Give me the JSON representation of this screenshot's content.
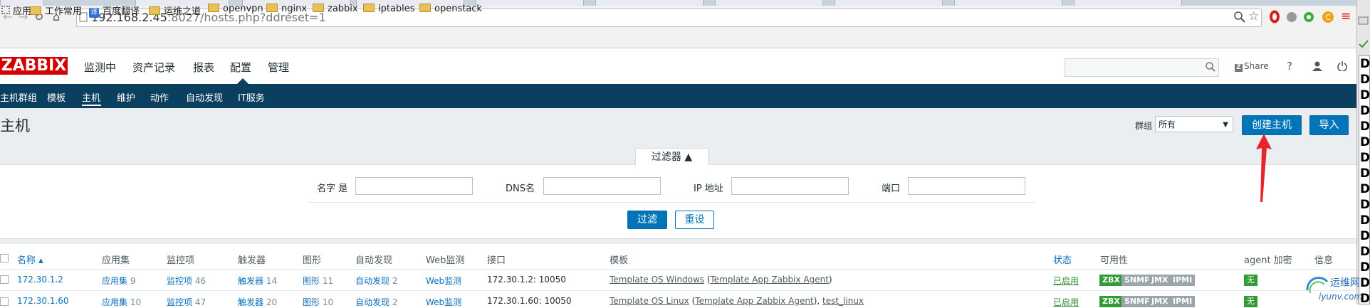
{
  "browser": {
    "url_host": "192.168.2.45",
    "url_rest": ":8027/hosts.php?ddreset=1",
    "bookmarks": [
      "应用",
      "工作常用",
      "百度翻译",
      "运维之道",
      "openvpn",
      "nginx",
      "zabbix",
      "iptables",
      "openstack"
    ]
  },
  "zabbix": {
    "logo": "ZABBIX",
    "main_menu": [
      "监测中",
      "资产记录",
      "报表",
      "配置",
      "管理"
    ],
    "share": "Share",
    "help": "?",
    "sub_menu": [
      "主机群组",
      "模板",
      "主机",
      "维护",
      "动作",
      "自动发现",
      "IT服务"
    ]
  },
  "page": {
    "title": "主机",
    "group_label": "群组",
    "group_value": "所有",
    "create_host": "创建主机",
    "import": "导入"
  },
  "filter": {
    "tab": "过滤器 ▲",
    "name_label": "名字 是",
    "dns_label": "DNS名",
    "ip_label": "IP 地址",
    "port_label": "端口",
    "apply": "过滤",
    "reset": "重设"
  },
  "table": {
    "headers": {
      "name": "名称 ▴",
      "apps": "应用集",
      "items": "监控项",
      "triggers": "触发器",
      "graphs": "图形",
      "discovery": "自动发现",
      "web": "Web监测",
      "interface": "接口",
      "templates": "模板",
      "status": "状态",
      "availability": "可用性",
      "agent_enc": "agent 加密",
      "info": "信息"
    },
    "rows": [
      {
        "name": "172.30.1.2",
        "apps": "应用集",
        "apps_n": "9",
        "items": "监控项",
        "items_n": "46",
        "triggers": "触发器",
        "triggers_n": "14",
        "graphs": "图形",
        "graphs_n": "11",
        "discovery": "自动发现",
        "discovery_n": "2",
        "web": "Web监测",
        "interface": "172.30.1.2: 10050",
        "template": "Template OS Windows",
        "template_paren": "Template App Zabbix Agent",
        "status": "已启用",
        "avail": [
          "ZBX",
          "SNMP",
          "JMX",
          "IPMI"
        ],
        "enc": "无"
      },
      {
        "name": "172.30.1.60",
        "apps": "应用集",
        "apps_n": "10",
        "items": "监控项",
        "items_n": "47",
        "triggers": "触发器",
        "triggers_n": "20",
        "graphs": "图形",
        "graphs_n": "10",
        "discovery": "自动发现",
        "discovery_n": "2",
        "web": "Web监测",
        "interface": "172.30.1.60: 10050",
        "template": "Template OS Linux",
        "template_paren": "Template App Zabbix Agent",
        "template_extra": "test_linux",
        "status": "已启用",
        "avail": [
          "ZBX",
          "SNMP",
          "JMX",
          "IPMI"
        ],
        "enc": "无"
      }
    ]
  },
  "side": {
    "letters": [
      "D",
      "D",
      "D",
      "D",
      "D",
      "D",
      "D",
      "D",
      "D",
      "D",
      "D",
      "D",
      "D",
      "D",
      "D",
      "D"
    ]
  },
  "watermark": {
    "cn": "运维网",
    "domain": "iyunv.com"
  },
  "colors": {
    "logo_red": "#d40000",
    "subnav": "#0b3f5f",
    "button_blue": "#0275b8",
    "status_green": "#2f9c36",
    "link_blue": "#0a6ebd",
    "arrow_red": "#e8242b"
  }
}
